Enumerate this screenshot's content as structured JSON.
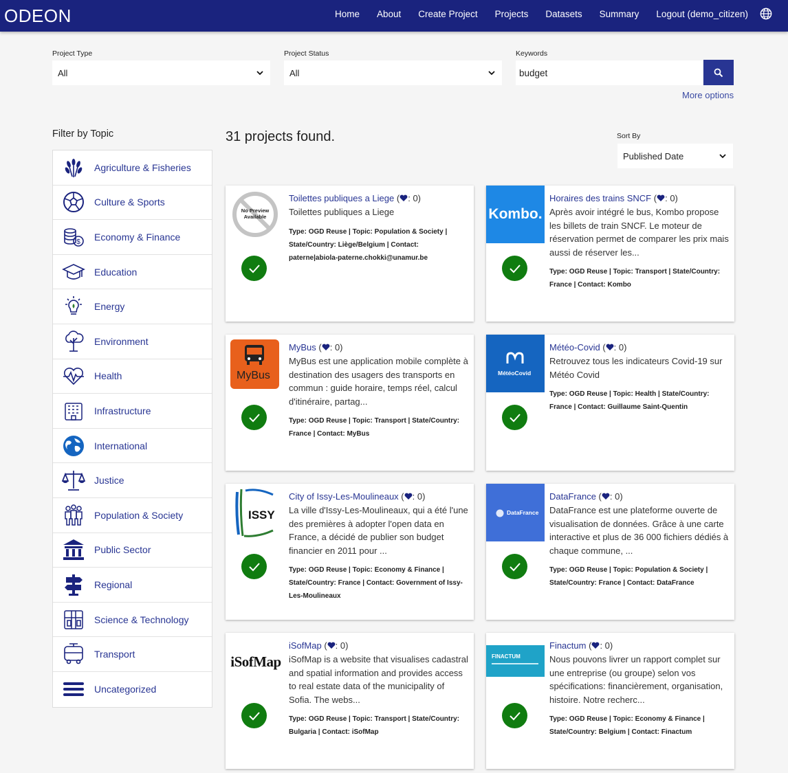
{
  "nav": {
    "brand": "ODEON",
    "links": [
      "Home",
      "About",
      "Create Project",
      "Projects",
      "Datasets",
      "Summary",
      "Logout (demo_citizen)"
    ],
    "globe_icon": "globe-icon"
  },
  "filters": {
    "project_type_label": "Project Type",
    "project_type_value": "All",
    "project_status_label": "Project Status",
    "project_status_value": "All",
    "keywords_label": "Keywords",
    "keywords_value": "budget",
    "search_icon": "search-icon",
    "more_options": "More options"
  },
  "sidebar": {
    "title": "Filter by Topic",
    "topics": [
      {
        "label": "Agriculture & Fisheries",
        "icon": "wheat-icon"
      },
      {
        "label": "Culture & Sports",
        "icon": "soccer-ball-icon"
      },
      {
        "label": "Economy & Finance",
        "icon": "coins-icon"
      },
      {
        "label": "Education",
        "icon": "graduation-cap-icon"
      },
      {
        "label": "Energy",
        "icon": "lightbulb-icon"
      },
      {
        "label": "Environment",
        "icon": "tree-icon"
      },
      {
        "label": "Health",
        "icon": "heartbeat-icon"
      },
      {
        "label": "Infrastructure",
        "icon": "building-icon"
      },
      {
        "label": "International",
        "icon": "globe-icon"
      },
      {
        "label": "Justice",
        "icon": "scales-icon"
      },
      {
        "label": "Population & Society",
        "icon": "people-icon"
      },
      {
        "label": "Public Sector",
        "icon": "government-building-icon"
      },
      {
        "label": "Regional",
        "icon": "signpost-icon"
      },
      {
        "label": "Science & Technology",
        "icon": "lab-icon"
      },
      {
        "label": "Transport",
        "icon": "bus-icon"
      },
      {
        "label": "Uncategorized",
        "icon": "menu-lines-icon"
      }
    ]
  },
  "results": {
    "count_text": "31 projects found.",
    "sort_label": "Sort By",
    "sort_value": "Published Date"
  },
  "projects": [
    {
      "title": "Toilettes publiques a Liege",
      "likes": "0",
      "description": "Toilettes publiques a Liege",
      "meta": "Type: OGD Reuse | Topic: Population & Society | State/Country: Liège/Belgium | Contact: paterne|abiola-paterne.chokki@unamur.be",
      "thumb": "No Preview Available"
    },
    {
      "title": "Horaires des trains SNCF",
      "likes": "0",
      "description": "Après avoir intégré le bus, Kombo propose les billets de train SNCF. Le moteur de réservation permet de comparer les prix mais aussi de réserver les...",
      "meta": "Type: OGD Reuse | Topic: Transport | State/Country: France | Contact: Kombo",
      "thumb": "Kombo."
    },
    {
      "title": "MyBus",
      "likes": "0",
      "description": "MyBus est une application mobile complète à destination des usagers des transports en commun : guide horaire, temps réel, calcul d'itinéraire, partag...",
      "meta": "Type: OGD Reuse | Topic: Transport | State/Country: France | Contact: MyBus",
      "thumb": "MyBus"
    },
    {
      "title": "Météo-Covid",
      "likes": "0",
      "description": "Retrouvez tous les indicateurs Covid-19 sur Météo Covid",
      "meta": "Type: OGD Reuse | Topic: Health | State/Country: France | Contact: Guillaume Saint-Quentin",
      "thumb": "MétéoCovid"
    },
    {
      "title": "City of Issy-Les-Moulineaux",
      "likes": "0",
      "description": "La ville d'Issy-Les-Moulineaux, qui a été l'une des premières à adopter l'open data en France, a décidé de publier son budget financier en 2011 pour ...",
      "meta": "Type: OGD Reuse | Topic: Economy & Finance | State/Country: France | Contact: Government of Issy-Les-Moulineaux",
      "thumb": "ISSY"
    },
    {
      "title": "DataFrance",
      "likes": "0",
      "description": "DataFrance est une plateforme ouverte de visualisation de données. Grâce à une carte interactive et plus de 36 000 fichiers dédiés à chaque commune, ...",
      "meta": "Type: OGD Reuse | Topic: Population & Society | State/Country: France | Contact: DataFrance",
      "thumb": "DataFrance"
    },
    {
      "title": "iSofMap",
      "likes": "0",
      "description": "iSofMap is a website that visualises cadastral and spatial information and provides access to real estate data of the municipality of Sofia. The webs...",
      "meta": "Type: OGD Reuse | Topic: Transport | State/Country: Bulgaria | Contact: iSofMap",
      "thumb": "iSofMap"
    },
    {
      "title": "Finactum",
      "likes": "0",
      "description": "Nous pouvons livrer un rapport complet sur une entreprise (ou groupe) selon vos spécifications: financièrement, organisation, histoire. Notre recherc...",
      "meta": "Type: OGD Reuse | Topic: Economy & Finance | State/Country: Belgium | Contact: Finactum",
      "thumb": "FINACTUM"
    }
  ],
  "colors": {
    "navbar": "#1a237e",
    "accent": "#283593",
    "check": "#107c10"
  }
}
